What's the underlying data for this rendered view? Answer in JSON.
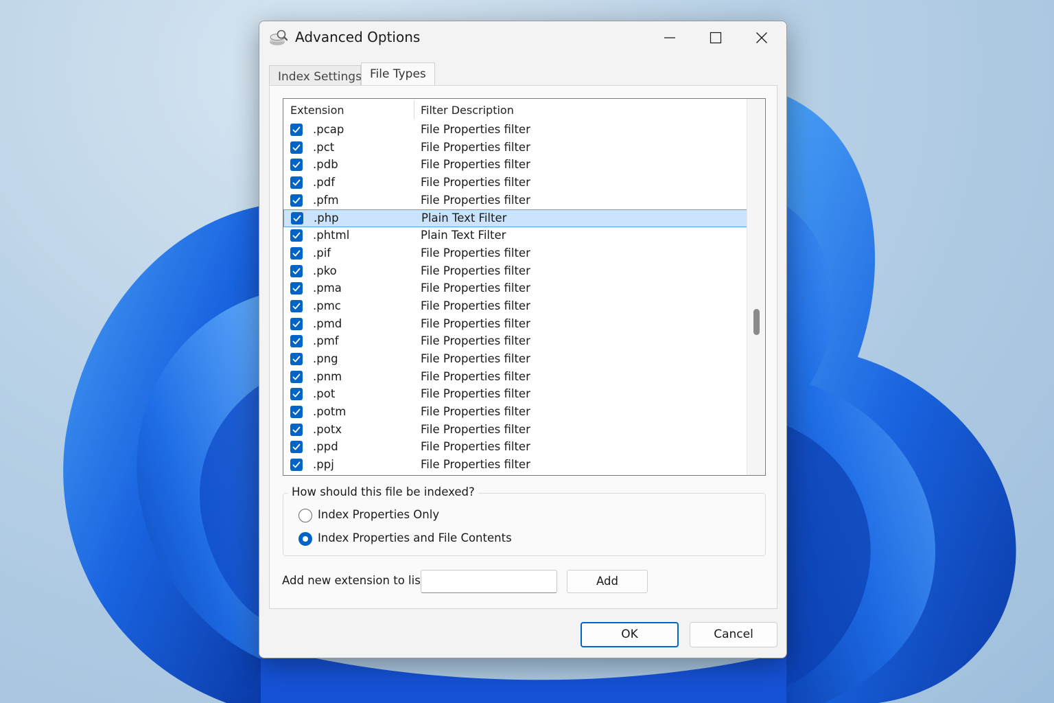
{
  "window": {
    "title": "Advanced Options",
    "app_icon": "indexing-options-icon"
  },
  "tabs": [
    {
      "label": "Index Settings",
      "active": false
    },
    {
      "label": "File Types",
      "active": true
    }
  ],
  "file_list": {
    "columns": [
      "Extension",
      "Filter Description"
    ],
    "rows": [
      {
        "ext": ".pcap",
        "desc": "File Properties filter",
        "checked": true,
        "selected": false
      },
      {
        "ext": ".pct",
        "desc": "File Properties filter",
        "checked": true,
        "selected": false
      },
      {
        "ext": ".pdb",
        "desc": "File Properties filter",
        "checked": true,
        "selected": false
      },
      {
        "ext": ".pdf",
        "desc": "File Properties filter",
        "checked": true,
        "selected": false
      },
      {
        "ext": ".pfm",
        "desc": "File Properties filter",
        "checked": true,
        "selected": false
      },
      {
        "ext": ".php",
        "desc": "Plain Text Filter",
        "checked": true,
        "selected": true
      },
      {
        "ext": ".phtml",
        "desc": "Plain Text Filter",
        "checked": true,
        "selected": false
      },
      {
        "ext": ".pif",
        "desc": "File Properties filter",
        "checked": true,
        "selected": false
      },
      {
        "ext": ".pko",
        "desc": "File Properties filter",
        "checked": true,
        "selected": false
      },
      {
        "ext": ".pma",
        "desc": "File Properties filter",
        "checked": true,
        "selected": false
      },
      {
        "ext": ".pmc",
        "desc": "File Properties filter",
        "checked": true,
        "selected": false
      },
      {
        "ext": ".pmd",
        "desc": "File Properties filter",
        "checked": true,
        "selected": false
      },
      {
        "ext": ".pmf",
        "desc": "File Properties filter",
        "checked": true,
        "selected": false
      },
      {
        "ext": ".png",
        "desc": "File Properties filter",
        "checked": true,
        "selected": false
      },
      {
        "ext": ".pnm",
        "desc": "File Properties filter",
        "checked": true,
        "selected": false
      },
      {
        "ext": ".pot",
        "desc": "File Properties filter",
        "checked": true,
        "selected": false
      },
      {
        "ext": ".potm",
        "desc": "File Properties filter",
        "checked": true,
        "selected": false
      },
      {
        "ext": ".potx",
        "desc": "File Properties filter",
        "checked": true,
        "selected": false
      },
      {
        "ext": ".ppd",
        "desc": "File Properties filter",
        "checked": true,
        "selected": false
      },
      {
        "ext": ".ppj",
        "desc": "File Properties filter",
        "checked": true,
        "selected": false
      }
    ]
  },
  "index_group": {
    "label": "How should this file be indexed?",
    "options": [
      {
        "label": "Index Properties Only",
        "selected": false
      },
      {
        "label": "Index Properties and File Contents",
        "selected": true
      }
    ]
  },
  "add_extension": {
    "label": "Add new extension to list:",
    "value": "",
    "button": "Add"
  },
  "buttons": {
    "ok": "OK",
    "cancel": "Cancel"
  },
  "colors": {
    "accent": "#0063c6",
    "selection": "#cce4fb"
  }
}
